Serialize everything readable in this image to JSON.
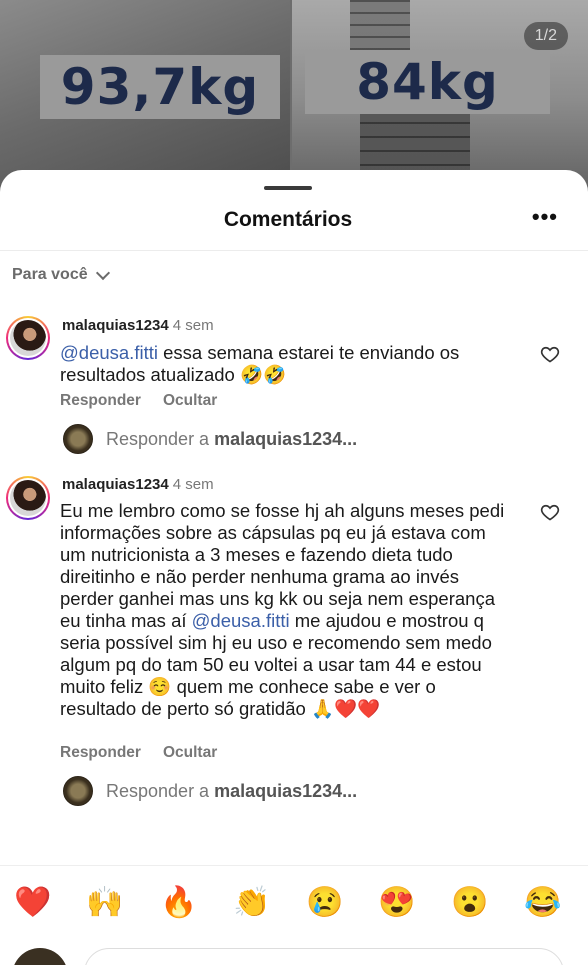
{
  "background": {
    "weight_before": "93,7kg",
    "weight_after": "84kg",
    "pager": "1/2"
  },
  "sheet": {
    "title": "Comentários",
    "more_icon": "more-horizontal-icon",
    "filter_label": "Para você"
  },
  "comments": [
    {
      "username": "malaquias1234",
      "time": "4 sem",
      "mention": "@deusa.fitti",
      "text_after_mention": " essa semana estarei te enviando os resultados atualizado 🤣🤣",
      "reply_label": "Responder",
      "hide_label": "Ocultar",
      "reply_to_prefix": "Responder a",
      "reply_to_user": "malaquias1234..."
    },
    {
      "username": "malaquias1234",
      "time": "4 sem",
      "text_before_mention": "Eu me lembro como se fosse hj ah alguns meses pedi informações sobre as cápsulas pq eu já estava com um nutricionista a 3 meses e fazendo dieta tudo direitinho e não perder nenhuma grama ao invés perder ganhei mas uns kg kk ou seja nem esperança eu tinha mas aí ",
      "mention": "@deusa.fitti",
      "text_after_mention": " me ajudou e mostrou q seria possível sim hj eu uso e recomendo sem medo algum pq do tam 50 eu voltei a usar tam 44  e estou muito feliz ☺️ quem me conhece sabe e ver o resultado de perto só gratidão 🙏❤️❤️",
      "reply_label": "Responder",
      "hide_label": "Ocultar",
      "reply_to_prefix": "Responder a",
      "reply_to_user": "malaquias1234..."
    }
  ],
  "emoji_reactions": [
    "❤️",
    "🙌",
    "🔥",
    "👏",
    "😢",
    "😍",
    "😮",
    "😂"
  ],
  "colors": {
    "mention": "#3b5fa8",
    "weight_text": "#1d2a4a"
  }
}
